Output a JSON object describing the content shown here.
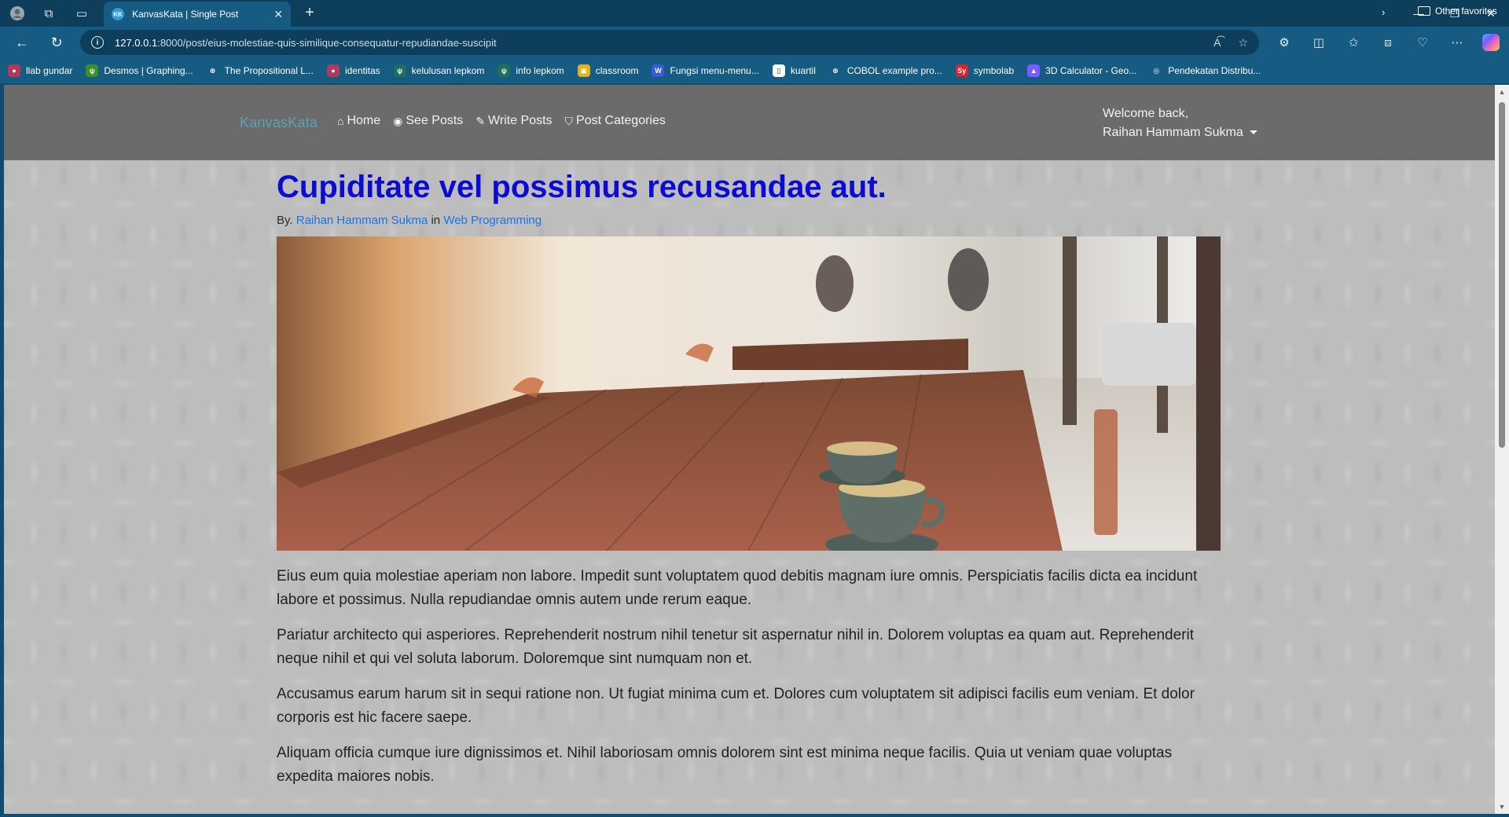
{
  "browser": {
    "tab_title": "KanvasKata | Single Post",
    "tab_favicon_text": "KK",
    "url_host": "127.0.0.1",
    "url_rest": ":8000/post/eius-molestiae-quis-similique-consequatur-repudiandae-suscipit",
    "bookmarks": [
      {
        "label": "llab gundar",
        "color": "#b03a5b",
        "glyph": "●"
      },
      {
        "label": "Desmos | Graphing...",
        "color": "#3f8f29",
        "glyph": "ψ"
      },
      {
        "label": "The Propositional L...",
        "color": "#165b82",
        "glyph": "⊕"
      },
      {
        "label": "identitas",
        "color": "#b03a5b",
        "glyph": "●"
      },
      {
        "label": "kelulusan lepkom",
        "color": "#1f6f5a",
        "glyph": "ψ"
      },
      {
        "label": "info lepkom",
        "color": "#1f6f5a",
        "glyph": "ψ"
      },
      {
        "label": "classroom",
        "color": "#e3b21b",
        "glyph": "▣"
      },
      {
        "label": "Fungsi menu-menu...",
        "color": "#3b5bd4",
        "glyph": "W"
      },
      {
        "label": "kuartil",
        "color": "#ffffff",
        "glyph": "▯"
      },
      {
        "label": "COBOL example pro...",
        "color": "#165b82",
        "glyph": "⊕"
      },
      {
        "label": "symbolab",
        "color": "#d8232a",
        "glyph": "Sy"
      },
      {
        "label": "3D Calculator - Geo...",
        "color": "#7b5cff",
        "glyph": "▲"
      },
      {
        "label": "Pendekatan Distribu...",
        "color": "#165b82",
        "glyph": "◎"
      }
    ],
    "other_favorites": "Other favorites"
  },
  "site": {
    "brand": "KanvasKata",
    "nav": [
      {
        "label": "Home",
        "icon": "⌂"
      },
      {
        "label": "See Posts",
        "icon": "◉"
      },
      {
        "label": "Write Posts",
        "icon": "✎"
      },
      {
        "label": "Post Categories",
        "icon": "⛉"
      }
    ],
    "welcome": "Welcome back,",
    "user": "Raihan Hammam Sukma"
  },
  "post": {
    "title": "Cupiditate vel possimus recusandae aut.",
    "by_prefix": "By.",
    "author": "Raihan Hammam Sukma",
    "in_word": "in",
    "category": "Web Programming",
    "paragraphs": [
      "Eius eum quia molestiae aperiam non labore. Impedit sunt voluptatem quod debitis magnam iure omnis. Perspiciatis facilis dicta ea incidunt labore et possimus. Nulla repudiandae omnis autem unde rerum eaque.",
      "Pariatur architecto qui asperiores. Reprehenderit nostrum nihil tenetur sit aspernatur nihil in. Dolorem voluptas ea quam aut. Reprehenderit neque nihil et qui vel soluta laborum. Doloremque sint numquam non et.",
      "Accusamus earum harum sit in sequi ratione non. Ut fugiat minima cum et. Dolores cum voluptatem sit adipisci facilis eum veniam. Et dolor corporis est hic facere saepe.",
      "Aliquam officia cumque iure dignissimos et. Nihil laboriosam omnis dolorem sint est minima neque facilis. Quia ut veniam quae voluptas expedita maiores nobis."
    ]
  }
}
